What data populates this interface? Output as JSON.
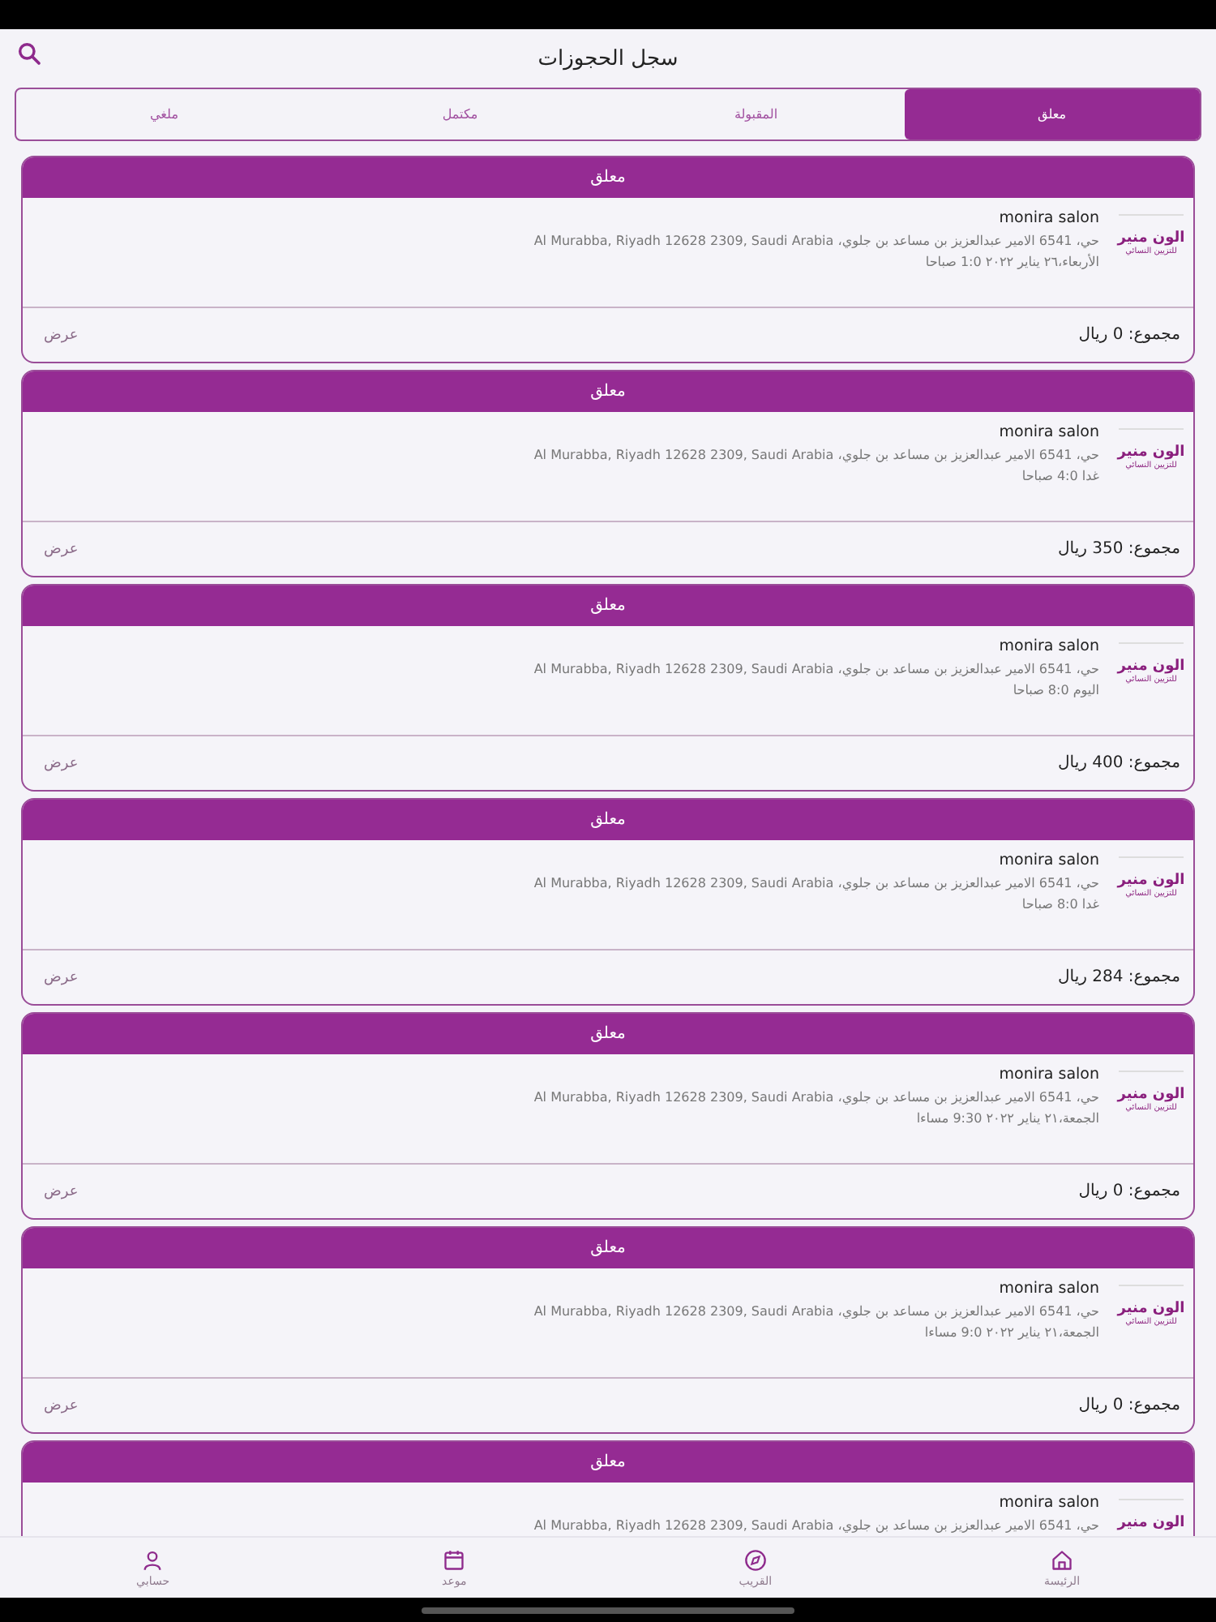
{
  "header": {
    "title": "سجل الحجوزات"
  },
  "tabs": [
    {
      "label": "معلق",
      "selected": true
    },
    {
      "label": "المقبولة",
      "selected": false
    },
    {
      "label": "مكتمل",
      "selected": false
    },
    {
      "label": "ملغي",
      "selected": false
    }
  ],
  "bookings": [
    {
      "status": "معلق",
      "salon": "monira salon",
      "logo": {
        "name": "الون منير",
        "tagline": "للتزيين النسائي"
      },
      "address": "حي، 6541 الامير عبدالعزيز بن مساعد بن جلوي، Al Murabba, Riyadh 12628 2309, Saudi Arabia",
      "when": "الأربعاء،٢٦ يناير ٢٠٢٢   1:0 صباحا",
      "total": "مجموع: 0 ريال",
      "action": "عرض"
    },
    {
      "status": "معلق",
      "salon": "monira salon",
      "logo": {
        "name": "الون منير",
        "tagline": "للتزيين النسائي"
      },
      "address": "حي، 6541 الامير عبدالعزيز بن مساعد بن جلوي، Al Murabba, Riyadh 12628 2309, Saudi Arabia",
      "when": "غدا   4:0 صباحا",
      "total": "مجموع: 350 ريال",
      "action": "عرض"
    },
    {
      "status": "معلق",
      "salon": "monira salon",
      "logo": {
        "name": "الون منير",
        "tagline": "للتزيين النسائي"
      },
      "address": "حي، 6541 الامير عبدالعزيز بن مساعد بن جلوي، Al Murabba, Riyadh 12628 2309, Saudi Arabia",
      "when": "اليوم   8:0 صباحا",
      "total": "مجموع: 400 ريال",
      "action": "عرض"
    },
    {
      "status": "معلق",
      "salon": "monira salon",
      "logo": {
        "name": "الون منير",
        "tagline": "للتزيين النسائي"
      },
      "address": "حي، 6541 الامير عبدالعزيز بن مساعد بن جلوي، Al Murabba, Riyadh 12628 2309, Saudi Arabia",
      "when": "غدا   8:0 صباحا",
      "total": "مجموع: 284 ريال",
      "action": "عرض"
    },
    {
      "status": "معلق",
      "salon": "monira salon",
      "logo": {
        "name": "الون منير",
        "tagline": "للتزيين النسائي"
      },
      "address": "حي، 6541 الامير عبدالعزيز بن مساعد بن جلوي، Al Murabba, Riyadh 12628 2309, Saudi Arabia",
      "when": "الجمعة،٢١ يناير ٢٠٢٢   9:30 مساءا",
      "total": "مجموع: 0 ريال",
      "action": "عرض"
    },
    {
      "status": "معلق",
      "salon": "monira salon",
      "logo": {
        "name": "الون منير",
        "tagline": "للتزيين النسائي"
      },
      "address": "حي، 6541 الامير عبدالعزيز بن مساعد بن جلوي، Al Murabba, Riyadh 12628 2309, Saudi Arabia",
      "when": "الجمعة،٢١ يناير ٢٠٢٢   9:0 مساءا",
      "total": "مجموع: 0 ريال",
      "action": "عرض"
    },
    {
      "status": "معلق",
      "salon": "monira salon",
      "logo": {
        "name": "الون منير"
      },
      "address": "حي، 6541 الامير عبدالعزيز بن مساعد بن جلوي، Al Murabba, Riyadh 12628 2309, Saudi Arabia"
    }
  ],
  "nav": [
    {
      "kind": "home",
      "label": "الرئيسة"
    },
    {
      "kind": "compass",
      "label": "القريب"
    },
    {
      "kind": "calendar",
      "label": "موعد"
    },
    {
      "kind": "person",
      "label": "حسابي"
    }
  ]
}
